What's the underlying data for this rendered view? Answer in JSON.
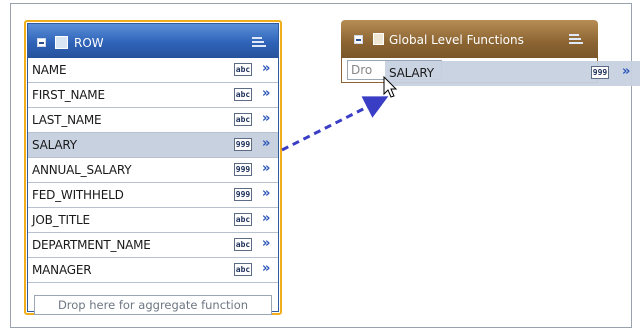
{
  "row_panel": {
    "title": "ROW",
    "fields": [
      {
        "name": "NAME",
        "type_badge": "abc",
        "selected": false
      },
      {
        "name": "FIRST_NAME",
        "type_badge": "abc",
        "selected": false
      },
      {
        "name": "LAST_NAME",
        "type_badge": "abc",
        "selected": false
      },
      {
        "name": "SALARY",
        "type_badge": "999",
        "selected": true
      },
      {
        "name": "ANNUAL_SALARY",
        "type_badge": "999",
        "selected": false
      },
      {
        "name": "FED_WITHHELD",
        "type_badge": "999",
        "selected": false
      },
      {
        "name": "JOB_TITLE",
        "type_badge": "abc",
        "selected": false
      },
      {
        "name": "DEPARTMENT_NAME",
        "type_badge": "abc",
        "selected": false
      },
      {
        "name": "MANAGER",
        "type_badge": "abc",
        "selected": false
      }
    ],
    "drop_placeholder": "Drop here for aggregate function"
  },
  "global_panel": {
    "title": "Global Level Functions",
    "drop_partial": "Dro"
  },
  "drag_ghost": {
    "name": "SALARY",
    "type_badge": "999"
  },
  "icons": {
    "collapse": "collapse-icon",
    "row": "row-table-icon",
    "global": "calendar-icon",
    "menu": "menu-icon",
    "expand": "chevron-right-icon"
  },
  "colors": {
    "row_header": "#2f63b8",
    "row_border": "#f0ae1a",
    "global_header": "#8b6432",
    "selected_row": "#c7d1df",
    "drag_arrow": "#3a3ec5"
  }
}
